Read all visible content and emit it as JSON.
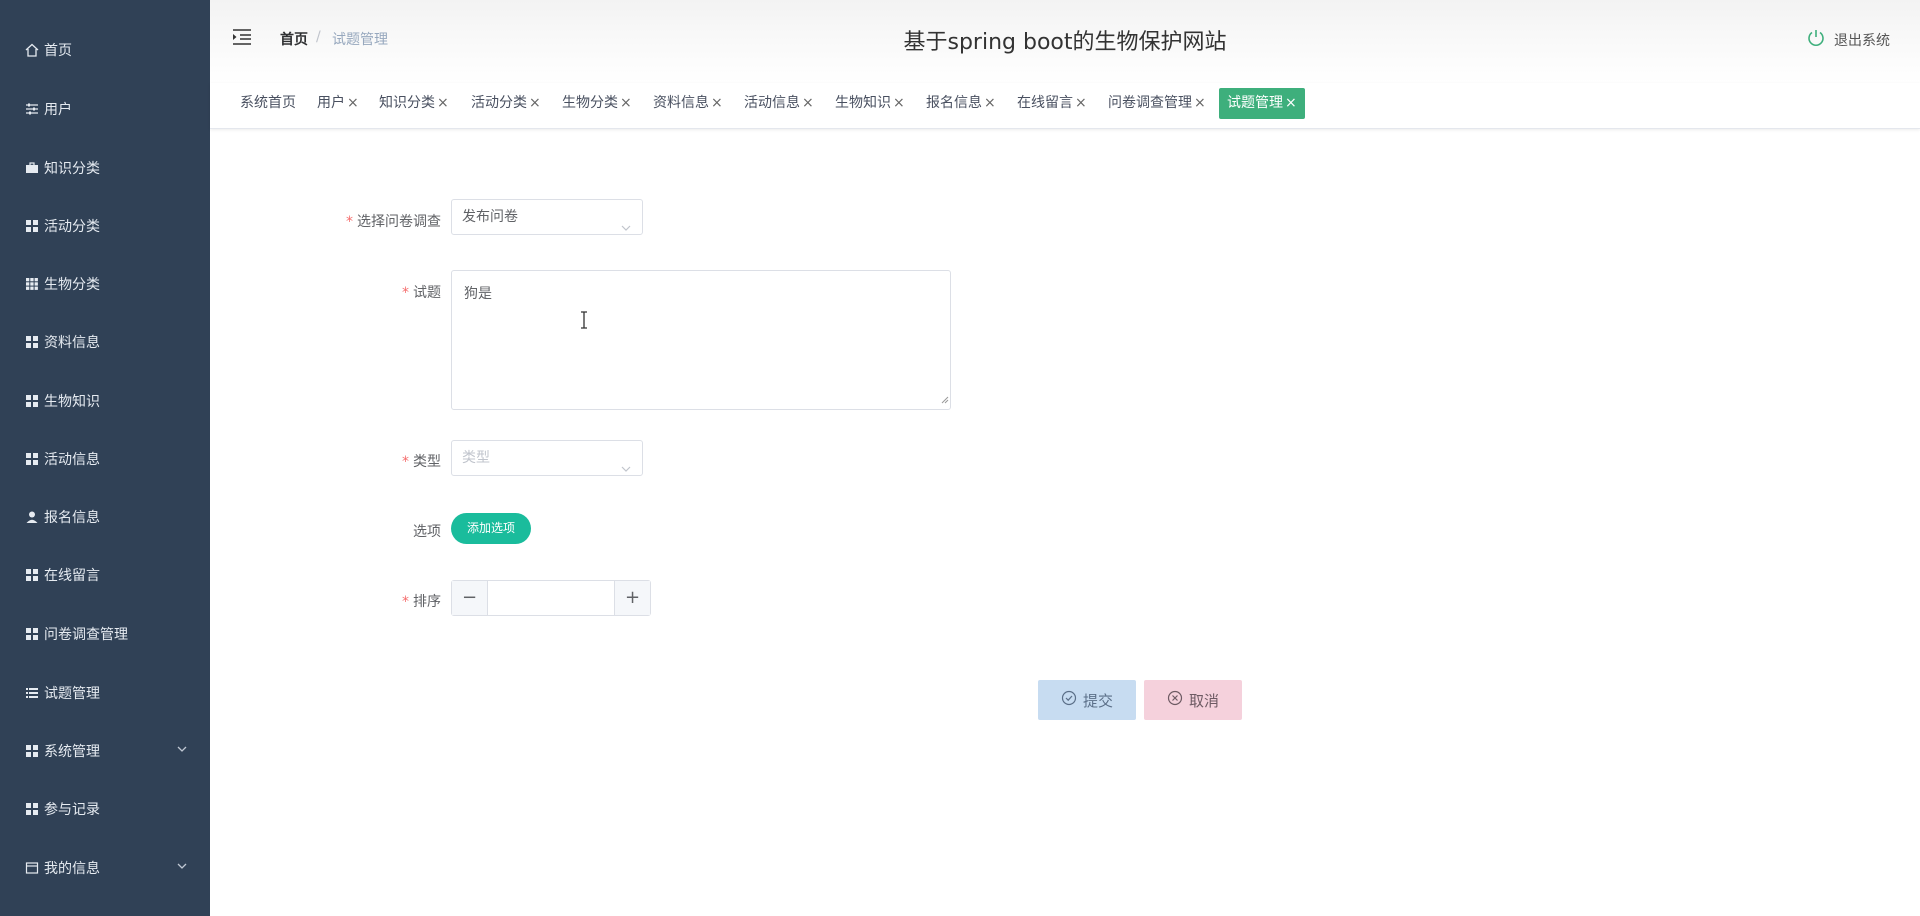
{
  "sidebar": {
    "items": [
      {
        "label": "首页",
        "icon": "home-icon"
      },
      {
        "label": "用户",
        "icon": "sliders-icon"
      },
      {
        "label": "知识分类",
        "icon": "briefcase-icon"
      },
      {
        "label": "活动分类",
        "icon": "grid-icon"
      },
      {
        "label": "生物分类",
        "icon": "grid9-icon"
      },
      {
        "label": "资料信息",
        "icon": "grid-icon"
      },
      {
        "label": "生物知识",
        "icon": "grid-icon"
      },
      {
        "label": "活动信息",
        "icon": "grid-icon"
      },
      {
        "label": "报名信息",
        "icon": "user-icon"
      },
      {
        "label": "在线留言",
        "icon": "grid-icon"
      },
      {
        "label": "问卷调查管理",
        "icon": "grid-icon"
      },
      {
        "label": "试题管理",
        "icon": "list-icon"
      },
      {
        "label": "系统管理",
        "icon": "grid-icon",
        "expandable": true
      },
      {
        "label": "参与记录",
        "icon": "grid-icon"
      },
      {
        "label": "我的信息",
        "icon": "card-icon",
        "expandable": true
      }
    ]
  },
  "header": {
    "breadcrumb": {
      "home": "首页",
      "separator": "/",
      "current": "试题管理"
    },
    "title": "基于spring boot的生物保护网站",
    "logout": "退出系统"
  },
  "tags": [
    {
      "label": "系统首页",
      "closable": false
    },
    {
      "label": "用户",
      "closable": true
    },
    {
      "label": "知识分类",
      "closable": true
    },
    {
      "label": "活动分类",
      "closable": true
    },
    {
      "label": "生物分类",
      "closable": true
    },
    {
      "label": "资料信息",
      "closable": true
    },
    {
      "label": "活动信息",
      "closable": true
    },
    {
      "label": "生物知识",
      "closable": true
    },
    {
      "label": "报名信息",
      "closable": true
    },
    {
      "label": "在线留言",
      "closable": true
    },
    {
      "label": "问卷调查管理",
      "closable": true
    },
    {
      "label": "试题管理",
      "closable": true,
      "active": true
    }
  ],
  "tag_close": "×",
  "form": {
    "survey": {
      "label": "选择问卷调查",
      "value": "发布问卷",
      "required": true
    },
    "question": {
      "label": "试题",
      "value": "狗是",
      "required": true
    },
    "type": {
      "label": "类型",
      "placeholder": "类型",
      "required": true
    },
    "options": {
      "label": "选项",
      "add_button": "添加选项"
    },
    "sort": {
      "label": "排序",
      "value": "",
      "minus": "−",
      "plus": "+",
      "required": true
    },
    "required_mark": "*"
  },
  "actions": {
    "submit": "提交",
    "cancel": "取消"
  },
  "colors": {
    "sidebar_bg": "#304156",
    "active_tag": "#3eaf7c",
    "add_button": "#1abc9c",
    "submit_bg": "#c7dcf1",
    "cancel_bg": "#f5d1dc",
    "required": "#f56c6c"
  }
}
